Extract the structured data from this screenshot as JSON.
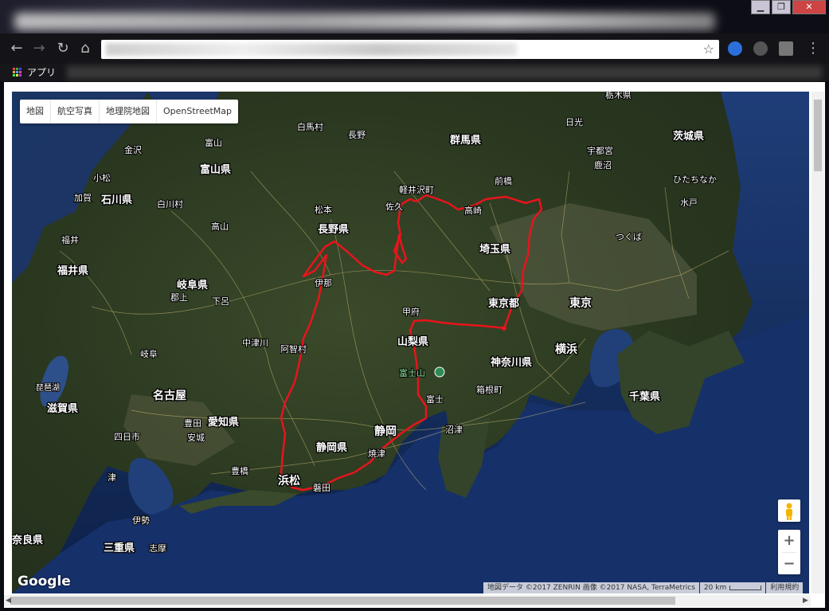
{
  "browser": {
    "window_buttons": [
      "▁",
      "❐",
      "✕"
    ],
    "nav_icons": [
      "back-icon",
      "forward-icon",
      "reload-icon",
      "home-icon"
    ],
    "bookmarks_label": "アプリ"
  },
  "map_controls": {
    "map_types": [
      "地図",
      "航空写真",
      "地理院地図",
      "OpenStreetMap"
    ],
    "zoom_in": "+",
    "zoom_out": "−",
    "logo": "Google",
    "attribution": "地図データ ©2017 ZENRIN 画像 ©2017 NASA, TerraMetrics",
    "scale": "20 km",
    "terms": "利用規約"
  },
  "map_labels": {
    "prefectures": [
      {
        "id": "ibaraki",
        "text": "茨城県"
      },
      {
        "id": "gunma",
        "text": "群馬県"
      },
      {
        "id": "toyama",
        "text": "富山県"
      },
      {
        "id": "ishikawa",
        "text": "石川県"
      },
      {
        "id": "nagano",
        "text": "長野県"
      },
      {
        "id": "saitama",
        "text": "埼玉県"
      },
      {
        "id": "fukui",
        "text": "福井県"
      },
      {
        "id": "gifu",
        "text": "岐阜県"
      },
      {
        "id": "tokyo",
        "text": "東京都"
      },
      {
        "id": "yamanashi",
        "text": "山梨県"
      },
      {
        "id": "kanagawa",
        "text": "神奈川県"
      },
      {
        "id": "shiga",
        "text": "滋賀県"
      },
      {
        "id": "aichi",
        "text": "愛知県"
      },
      {
        "id": "shizuoka",
        "text": "静岡県"
      },
      {
        "id": "chiba",
        "text": "千葉県"
      },
      {
        "id": "mie",
        "text": "三重県"
      },
      {
        "id": "nara",
        "text": "奈良県"
      }
    ],
    "major_cities": [
      {
        "id": "tokyo",
        "text": "東京"
      },
      {
        "id": "yokohama",
        "text": "横浜"
      },
      {
        "id": "nagoya",
        "text": "名古屋"
      },
      {
        "id": "shizuoka",
        "text": "静岡"
      },
      {
        "id": "hamamatsu",
        "text": "浜松"
      }
    ],
    "cities": [
      {
        "id": "nikko",
        "text": "日光"
      },
      {
        "id": "shirakawa",
        "text": "白馬村"
      },
      {
        "id": "nagano",
        "text": "長野"
      },
      {
        "id": "toyama",
        "text": "富山"
      },
      {
        "id": "kanazawa",
        "text": "金沢"
      },
      {
        "id": "utsunomiya",
        "text": "宇都宮"
      },
      {
        "id": "kanuma",
        "text": "鹿沼"
      },
      {
        "id": "komatsu",
        "text": "小松"
      },
      {
        "id": "shirakawa2",
        "text": "白川村"
      },
      {
        "id": "maebashi",
        "text": "前橋"
      },
      {
        "id": "hitachinaka",
        "text": "ひたちなか"
      },
      {
        "id": "mito",
        "text": "水戸"
      },
      {
        "id": "karuizawa",
        "text": "軽井沢町"
      },
      {
        "id": "kaga",
        "text": "加賀"
      },
      {
        "id": "matsumoto",
        "text": "松本"
      },
      {
        "id": "saku",
        "text": "佐久"
      },
      {
        "id": "takasaki",
        "text": "高崎"
      },
      {
        "id": "takayama",
        "text": "高山"
      },
      {
        "id": "fukui",
        "text": "福井"
      },
      {
        "id": "tsukuba",
        "text": "つくば"
      },
      {
        "id": "ina",
        "text": "伊那"
      },
      {
        "id": "gujo",
        "text": "郡上"
      },
      {
        "id": "gero",
        "text": "下呂"
      },
      {
        "id": "kofu",
        "text": "甲府"
      },
      {
        "id": "nakatsugawa",
        "text": "中津川"
      },
      {
        "id": "achi",
        "text": "阿智村"
      },
      {
        "id": "gifu",
        "text": "岐阜"
      },
      {
        "id": "fuji_mt",
        "text": "富士山"
      },
      {
        "id": "hakone",
        "text": "箱根町"
      },
      {
        "id": "fuji",
        "text": "富士"
      },
      {
        "id": "toyota",
        "text": "豊田"
      },
      {
        "id": "anjo",
        "text": "安城"
      },
      {
        "id": "yokkaichi",
        "text": "四日市"
      },
      {
        "id": "numazu",
        "text": "沼津"
      },
      {
        "id": "yaizu",
        "text": "焼津"
      },
      {
        "id": "toyohashi",
        "text": "豊橋"
      },
      {
        "id": "tsu",
        "text": "津"
      },
      {
        "id": "iwata",
        "text": "磐田"
      },
      {
        "id": "ise",
        "text": "伊勢"
      },
      {
        "id": "shima",
        "text": "志摩"
      },
      {
        "id": "biwako",
        "text": "琵琶湖"
      },
      {
        "id": "tochigi_edge",
        "text": "栃木県"
      }
    ]
  },
  "colors": {
    "route": "#e8141c",
    "label": "#ffffff",
    "sea_deep": "#142a55",
    "land": "#2e3d22"
  }
}
